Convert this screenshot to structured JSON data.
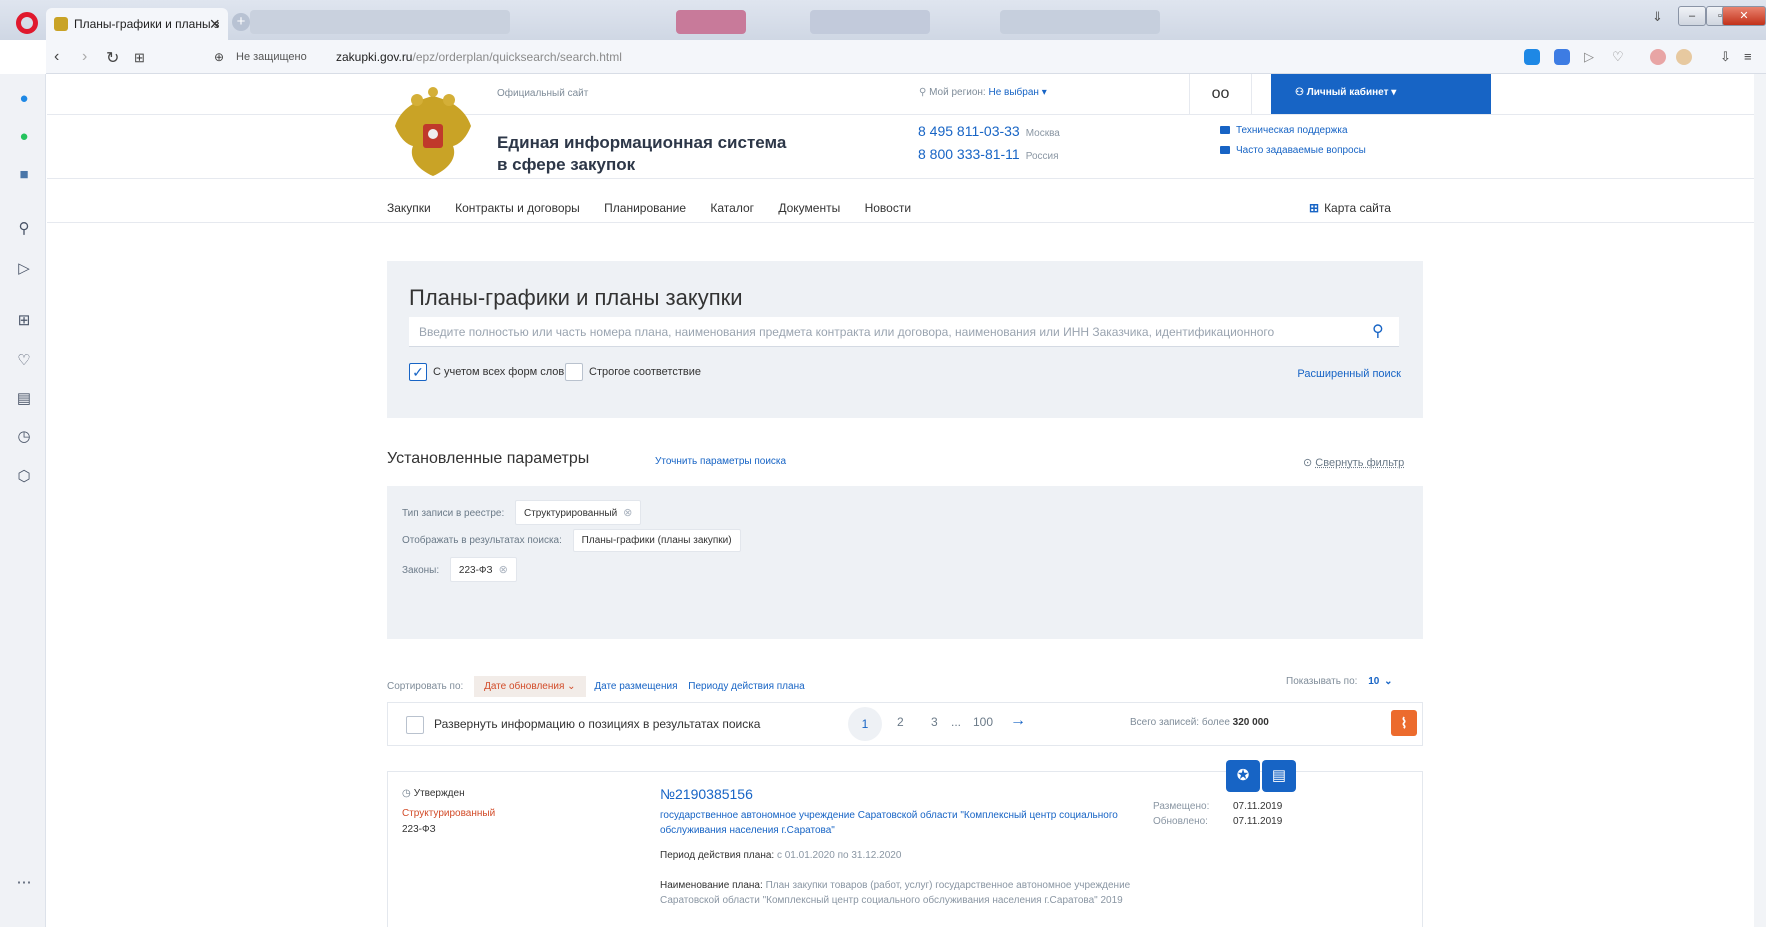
{
  "browser": {
    "tab_title": "Планы-графики и планы з",
    "insecure_label": "Не защищено",
    "url_domain": "zakupki.gov.ru",
    "url_path": "/epz/orderplan/quicksearch/search.html"
  },
  "header": {
    "official_label": "Официальный сайт",
    "site_name_line1": "Единая информационная система",
    "site_name_line2": "в сфере закупок",
    "region_label": "Мой регион:",
    "region_value": "Не выбран",
    "cabinet_label": "Личный кабинет",
    "phones": [
      {
        "number": "8 495 811-03-33",
        "city": "Москва"
      },
      {
        "number": "8 800 333-81-11",
        "city": "Россия"
      }
    ],
    "support_label": "Техническая поддержка",
    "faq_label": "Часто задаваемые вопросы"
  },
  "menu": {
    "items": [
      "Закупки",
      "Контракты и договоры",
      "Планирование",
      "Каталог",
      "Документы",
      "Новости"
    ],
    "sitemap_label": "Карта сайта"
  },
  "search": {
    "title": "Планы-графики и планы закупки",
    "placeholder": "Введите полностью или часть номера плана, наименования предмета контракта или договора, наименования или ИНН Заказчика, идентификационного",
    "word_forms_label": "С учетом всех форм слов",
    "strict_label": "Строгое соответствие",
    "extended_label": "Расширенный поиск"
  },
  "params": {
    "title": "Установленные параметры",
    "refine_label": "Уточнить параметры поиска",
    "collapse_label": "Свернуть фильтр",
    "rows": [
      {
        "label": "Тип записи в реестре:",
        "value": "Структурированный"
      },
      {
        "label": "Отображать в результатах поиска:",
        "value": "Планы-графики (планы закупки)"
      },
      {
        "label": "Законы:",
        "value": "223-ФЗ"
      }
    ]
  },
  "sort": {
    "label": "Сортировать по:",
    "active": "Дате обновления",
    "options": [
      "Дате размещения",
      "Периоду действия плана"
    ],
    "page_size_label": "Показывать по:",
    "page_size": "10"
  },
  "results": {
    "expand_label": "Развернуть информацию о позициях в результатах поиска",
    "pages": [
      "1",
      "2",
      "3",
      "...",
      "100"
    ],
    "total_label": "Всего записей: более",
    "total_value": "320 000"
  },
  "card": {
    "status": "Утвержден",
    "type": "Структурированный",
    "law": "223-ФЗ",
    "number": "№2190385156",
    "customer": "государственное автономное учреждение Саратовской области \"Комплексный центр социального обслуживания населения г.Саратова\"",
    "period_label": "Период действия плана:",
    "period_value": "с 01.01.2020 по 31.12.2020",
    "plan_name_label": "Наименование плана:",
    "plan_name_value": "План закупки товаров (работ, услуг) государственное автономное учреждение Саратовской области \"Комплексный центр социального обслуживания населения г.Саратова\" 2019",
    "posted_label": "Размещено:",
    "posted_value": "07.11.2019",
    "updated_label": "Обновлено:",
    "updated_value": "07.11.2019"
  }
}
